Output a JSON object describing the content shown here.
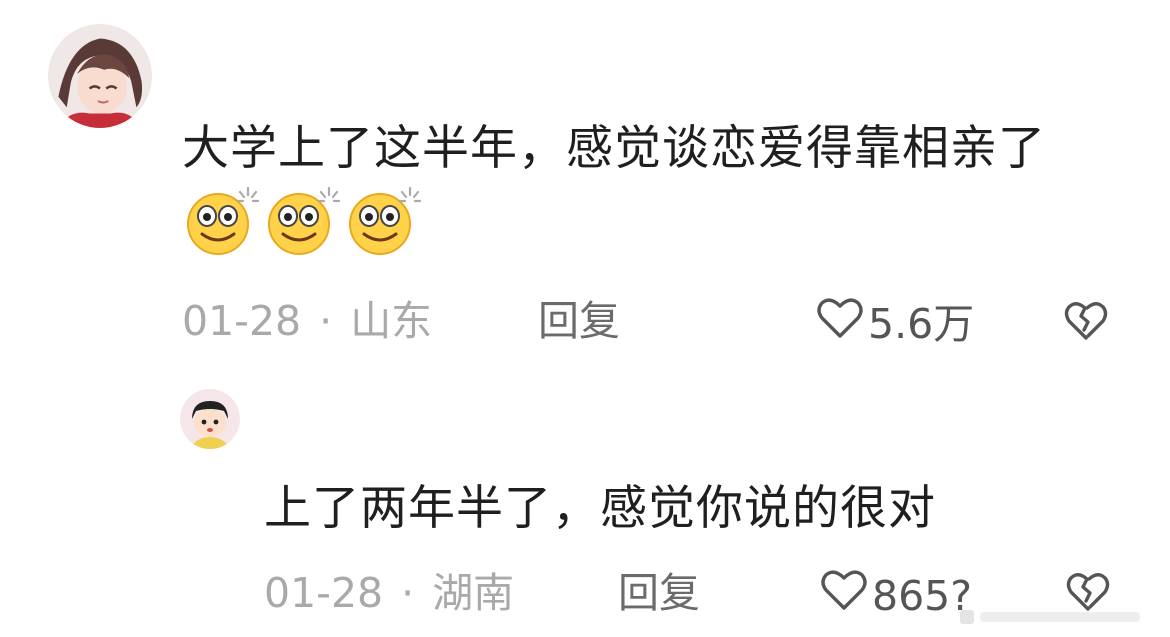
{
  "comments": [
    {
      "text": "大学上了这半年，感觉谈恋爱得靠相亲了",
      "emojis": [
        "dizzy-eyes-emoji",
        "dizzy-eyes-emoji",
        "dizzy-eyes-emoji"
      ],
      "date": "01-28",
      "location": "山东",
      "separator": "·",
      "reply_label": "回复",
      "likes": "5.6万"
    },
    {
      "text": "上了两年半了，感觉你说的很对",
      "date": "01-28",
      "location": "湖南",
      "separator": "·",
      "reply_label": "回复",
      "likes": "865?"
    }
  ],
  "icons": {
    "like": "heart-outline-icon",
    "dislike": "broken-heart-icon"
  },
  "colors": {
    "text": "#1f1f1f",
    "meta": "#a9a9a9",
    "reply": "#6b6b6b",
    "emoji_face": "#ffd24a"
  }
}
